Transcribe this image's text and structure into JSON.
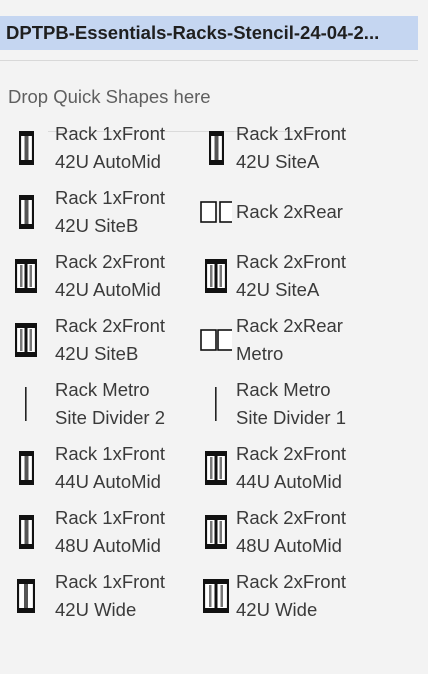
{
  "stencil": {
    "title": "DPTPB-Essentials-Racks-Stencil-24-04-2...",
    "quick_shapes_hint": "Drop Quick Shapes here"
  },
  "shapes": [
    {
      "icon": "rack-1x-front-icon",
      "line1": "Rack 1xFront",
      "line2": "42U AutoMid"
    },
    {
      "icon": "rack-1x-front-icon",
      "line1": "Rack 1xFront",
      "line2": "42U SiteA"
    },
    {
      "icon": "rack-1x-front-icon",
      "line1": "Rack 1xFront",
      "line2": "42U SiteB"
    },
    {
      "icon": "rack-2x-rear-icon",
      "line1": "Rack 2xRear",
      "line2": ""
    },
    {
      "icon": "rack-2x-front-icon",
      "line1": "Rack 2xFront",
      "line2": "42U AutoMid"
    },
    {
      "icon": "rack-2x-front-icon",
      "line1": "Rack 2xFront",
      "line2": "42U SiteA"
    },
    {
      "icon": "rack-2x-front-icon",
      "line1": "Rack 2xFront",
      "line2": "42U SiteB"
    },
    {
      "icon": "rack-2x-rear-metro-icon",
      "line1": "Rack 2xRear",
      "line2": "Metro"
    },
    {
      "icon": "site-divider-icon",
      "line1": "Rack Metro",
      "line2": "Site Divider 2"
    },
    {
      "icon": "site-divider-icon",
      "line1": "Rack Metro",
      "line2": "Site Divider 1"
    },
    {
      "icon": "rack-1x-front-icon",
      "line1": "Rack 1xFront",
      "line2": "44U AutoMid"
    },
    {
      "icon": "rack-2x-front-icon",
      "line1": "Rack 2xFront",
      "line2": "44U AutoMid"
    },
    {
      "icon": "rack-1x-front-icon",
      "line1": "Rack 1xFront",
      "line2": "48U AutoMid"
    },
    {
      "icon": "rack-2x-front-icon",
      "line1": "Rack 2xFront",
      "line2": "48U AutoMid"
    },
    {
      "icon": "rack-1x-front-wide-icon",
      "line1": "Rack 1xFront",
      "line2": "42U Wide"
    },
    {
      "icon": "rack-2x-front-wide-icon",
      "line1": "Rack 2xFront",
      "line2": "42U Wide"
    }
  ]
}
